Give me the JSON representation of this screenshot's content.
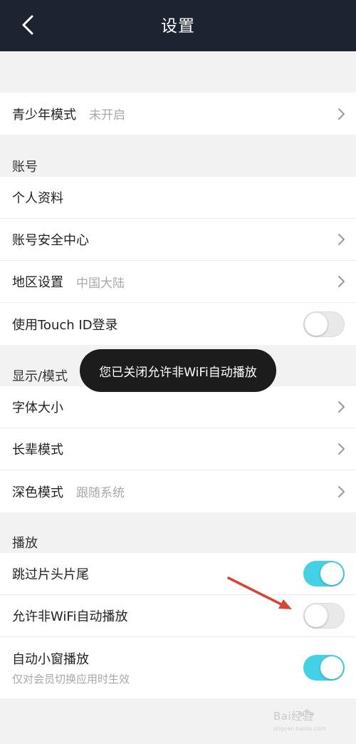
{
  "header": {
    "title": "设置",
    "back_icon": "chevron-left-icon"
  },
  "youth": {
    "label": "青少年模式",
    "value": "未开启"
  },
  "account": {
    "section_title": "账号",
    "items": [
      {
        "label": "个人资料"
      },
      {
        "label": "账号安全中心"
      },
      {
        "label": "地区设置",
        "value": "中国大陆"
      },
      {
        "label": "使用Touch ID登录",
        "toggle": "off"
      }
    ]
  },
  "display": {
    "section_title": "显示/模式",
    "items": [
      {
        "label": "字体大小"
      },
      {
        "label": "长辈模式"
      },
      {
        "label": "深色模式",
        "value": "跟随系统"
      }
    ]
  },
  "playback": {
    "section_title": "播放",
    "items": [
      {
        "label": "跳过片头片尾",
        "toggle": "on"
      },
      {
        "label": "允许非WiFi自动播放",
        "toggle": "off"
      },
      {
        "label": "自动小窗播放",
        "sub": "仅对会员切换应用时生效",
        "toggle": "on"
      }
    ]
  },
  "toast": {
    "text": "您已关闭允许非WiFi自动播放"
  },
  "annotation": {
    "arrow_color": "#d9443a"
  },
  "colors": {
    "header_bg": "#1d2330",
    "toggle_on": "#43d1e8",
    "toggle_off": "#e9e9e9",
    "background": "#f2f2f2"
  },
  "watermark": {
    "text": "Bai经验",
    "sub": "jingyan.baidu.com"
  }
}
